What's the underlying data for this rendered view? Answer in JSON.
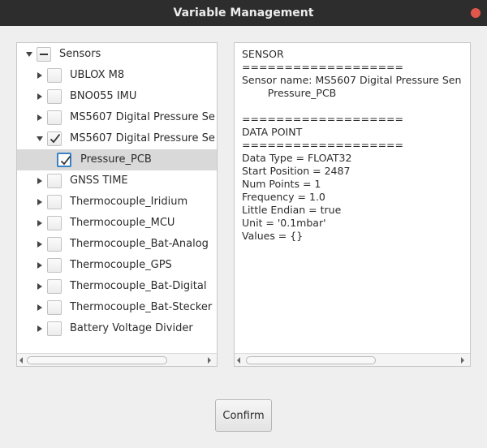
{
  "window": {
    "title": "Variable Management"
  },
  "tree": {
    "items": [
      {
        "label": "Sensors",
        "level": 0,
        "expander": "down",
        "check": "indeterminate",
        "selected": false
      },
      {
        "label": "UBLOX M8",
        "level": 1,
        "expander": "right",
        "check": "unchecked",
        "selected": false
      },
      {
        "label": "BNO055 IMU",
        "level": 1,
        "expander": "right",
        "check": "unchecked",
        "selected": false
      },
      {
        "label": "MS5607 Digital Pressure Se",
        "level": 1,
        "expander": "right",
        "check": "unchecked",
        "selected": false
      },
      {
        "label": "MS5607 Digital Pressure Se",
        "level": 1,
        "expander": "down",
        "check": "checked",
        "selected": false
      },
      {
        "label": "Pressure_PCB",
        "level": 2,
        "expander": "none",
        "check": "checked-focused",
        "selected": true
      },
      {
        "label": "GNSS TIME",
        "level": 1,
        "expander": "right",
        "check": "unchecked",
        "selected": false
      },
      {
        "label": "Thermocouple_Iridium",
        "level": 1,
        "expander": "right",
        "check": "unchecked",
        "selected": false
      },
      {
        "label": "Thermocouple_MCU",
        "level": 1,
        "expander": "right",
        "check": "unchecked",
        "selected": false
      },
      {
        "label": "Thermocouple_Bat-Analog",
        "level": 1,
        "expander": "right",
        "check": "unchecked",
        "selected": false
      },
      {
        "label": "Thermocouple_GPS",
        "level": 1,
        "expander": "right",
        "check": "unchecked",
        "selected": false
      },
      {
        "label": "Thermocouple_Bat-Digital",
        "level": 1,
        "expander": "right",
        "check": "unchecked",
        "selected": false
      },
      {
        "label": "Thermocouple_Bat-Stecker",
        "level": 1,
        "expander": "right",
        "check": "unchecked",
        "selected": false
      },
      {
        "label": "Battery Voltage Divider",
        "level": 1,
        "expander": "right",
        "check": "unchecked",
        "selected": false
      }
    ]
  },
  "details": {
    "lines": [
      "SENSOR",
      "===================",
      "Sensor name: MS5607 Digital Pressure Sen",
      "        Pressure_PCB",
      "",
      "===================",
      "DATA POINT",
      "===================",
      "Data Type = FLOAT32",
      "Start Position = 2487",
      "Num Points = 1",
      "Frequency = 1.0",
      "Little Endian = true",
      "Unit = '0.1mbar'",
      "Values = {}"
    ]
  },
  "buttons": {
    "confirm": "Confirm"
  },
  "colors": {
    "titlebar": "#2d2d2d",
    "close": "#e2574c",
    "selection": "#d9d9d9",
    "focus": "#3b82c4"
  }
}
